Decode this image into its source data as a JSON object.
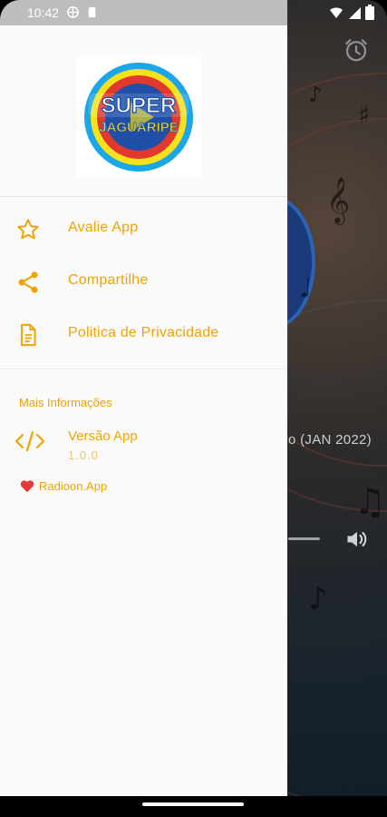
{
  "status_bar": {
    "time": "10:42",
    "left_icons": [
      "vpn-icon",
      "sd-card-icon"
    ],
    "right_icons": [
      "wifi-icon",
      "signal-icon",
      "battery-icon"
    ]
  },
  "drawer": {
    "logo": {
      "line1": "SUPER",
      "line2": "JAGUARIPE"
    },
    "menu": [
      {
        "icon": "star-outline-icon",
        "label": "Avalie App"
      },
      {
        "icon": "share-icon",
        "label": "Compartilhe"
      },
      {
        "icon": "document-icon",
        "label": "Politica de Privacidade"
      }
    ],
    "more_info": {
      "title": "Mais Informações",
      "version_label": "Versão App",
      "version_value": "1.0.0",
      "credit": "Radioon.App"
    }
  },
  "background": {
    "track_text": "o (JAN 2022)",
    "icons": [
      "alarm-icon",
      "volume-icon"
    ]
  },
  "colors": {
    "accent": "#f2a300",
    "drawer_bg": "#fafafa",
    "status_bar": "#bdbdbd",
    "heart": "#e53935"
  }
}
